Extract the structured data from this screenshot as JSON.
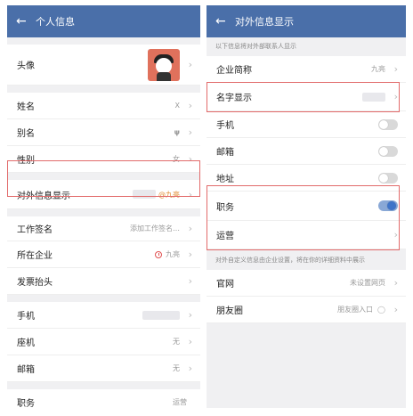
{
  "left": {
    "header": {
      "back_icon": "arrow-left-icon",
      "title": "个人信息"
    },
    "rows": {
      "avatar": {
        "label": "头像"
      },
      "name": {
        "label": "姓名",
        "value": "X"
      },
      "alias": {
        "label": "别名",
        "icon": "sprout-icon"
      },
      "gender": {
        "label": "性别",
        "value": "女"
      },
      "external_display": {
        "label": "对外信息显示",
        "value": "@九亮"
      },
      "work_signature": {
        "label": "工作签名",
        "value": "添加工作签名…"
      },
      "company": {
        "label": "所在企业",
        "value": "九亮"
      },
      "invoice_title": {
        "label": "发票抬头"
      },
      "phone": {
        "label": "手机"
      },
      "landline": {
        "label": "座机",
        "value": "无"
      },
      "email": {
        "label": "邮箱",
        "value": "无"
      },
      "position": {
        "label": "职务",
        "value": "运营"
      }
    }
  },
  "right": {
    "header": {
      "back_icon": "arrow-left-icon",
      "title": "对外信息显示"
    },
    "section1_note": "以下信息将对外部联系人显示",
    "rows": {
      "company_short": {
        "label": "企业简称",
        "value": "九亮"
      },
      "name_display": {
        "label": "名字显示"
      },
      "phone": {
        "label": "手机",
        "toggle_on": false
      },
      "email": {
        "label": "邮箱",
        "toggle_on": false
      },
      "address": {
        "label": "地址",
        "toggle_on": false
      },
      "position": {
        "label": "职务",
        "toggle_on": true
      },
      "operations": {
        "label": "运营"
      }
    },
    "section2_note": "对外自定义信息由企业设置，将在你的详细资料中展示",
    "rows2": {
      "website": {
        "label": "官网",
        "value": "未设置网页"
      },
      "moments": {
        "label": "朋友圈",
        "value": "朋友圈入口"
      }
    }
  },
  "colors": {
    "header": "#4a6fa9",
    "highlight": "#e26b6b",
    "toggle_on": "#3f74c8"
  }
}
